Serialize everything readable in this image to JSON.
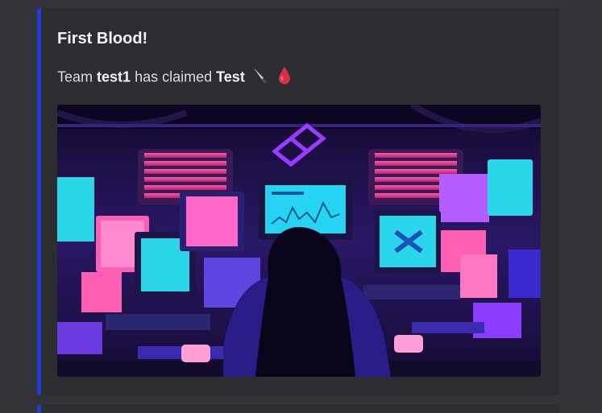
{
  "embed": {
    "accent_color": "#1f3ad6",
    "title": "First Blood!",
    "description": {
      "prefix": "Team",
      "team_name": "test1",
      "middle": "has claimed",
      "challenge_name": "Test",
      "emojis": [
        "knife-icon",
        "drop-of-blood-icon"
      ]
    },
    "image": {
      "subject": "pixel-art-hacker-at-monitors"
    }
  }
}
